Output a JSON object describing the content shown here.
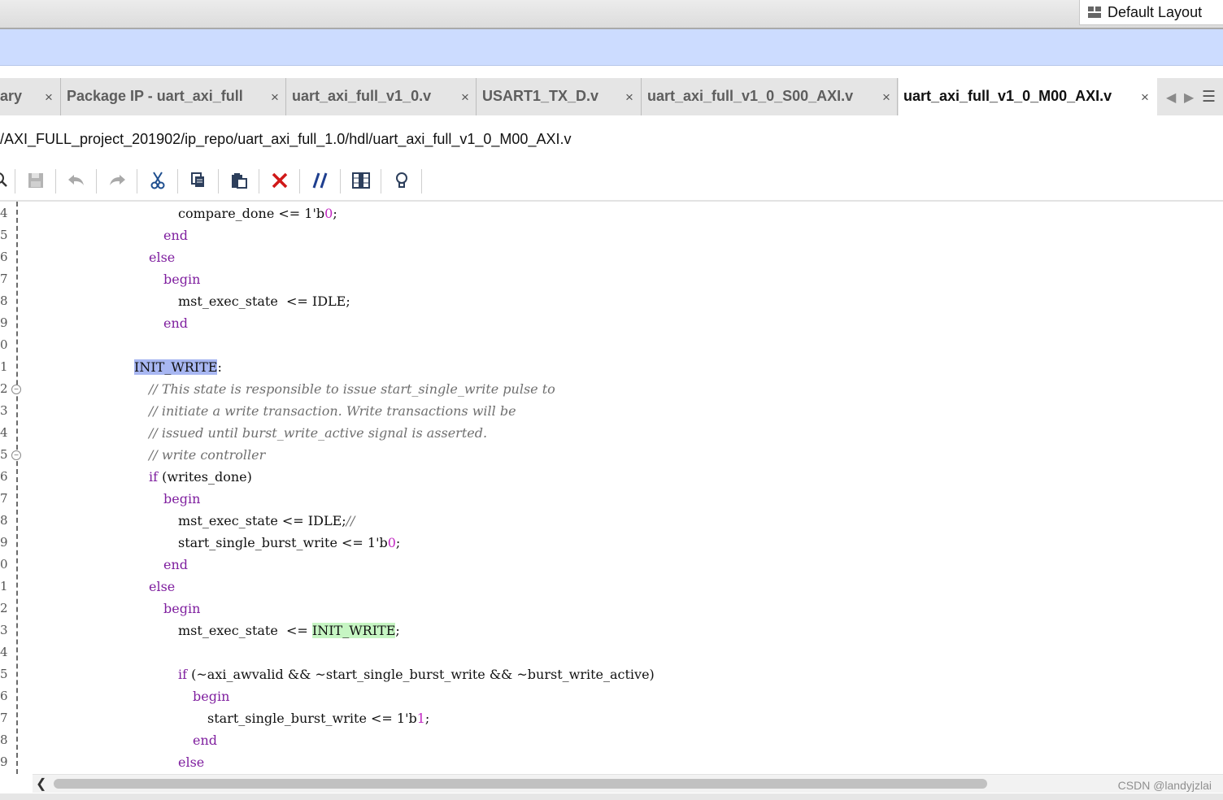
{
  "top_bar": {
    "layout_label": "Default Layout"
  },
  "tabs": [
    {
      "label": "ary",
      "active": false
    },
    {
      "label": "Package IP - uart_axi_full",
      "active": false
    },
    {
      "label": "uart_axi_full_v1_0.v",
      "active": false
    },
    {
      "label": "USART1_TX_D.v",
      "active": false
    },
    {
      "label": "uart_axi_full_v1_0_S00_AXI.v",
      "active": false
    },
    {
      "label": "uart_axi_full_v1_0_M00_AXI.v",
      "active": true
    }
  ],
  "close_glyph": "×",
  "file_path": "/AXI_FULL_project_201902/ip_repo/uart_axi_full_1.0/hdl/uart_axi_full_v1_0_M00_AXI.v",
  "toolbar_icons": [
    "search-icon",
    "save-icon",
    "undo-icon",
    "redo-icon",
    "cut-icon",
    "copy-icon",
    "paste-icon",
    "delete-icon",
    "comment-icon",
    "column-select-icon",
    "quick-help-icon"
  ],
  "line_numbers": [
    "4",
    "5",
    "6",
    "7",
    "8",
    "9",
    "0",
    "1",
    "2",
    "3",
    "4",
    "5",
    "6",
    "7",
    "8",
    "9",
    "0",
    "1",
    "2",
    "3",
    "4",
    "5",
    "6",
    "7",
    "8",
    "9"
  ],
  "code_lines": [
    {
      "indent": 0,
      "tokens": [
        {
          "t": "compare_done <= 1'b"
        },
        {
          "t": "0",
          "c": "num"
        },
        {
          "t": ";"
        }
      ]
    },
    {
      "indent": 1,
      "tokens": [
        {
          "t": "end",
          "c": "kw"
        }
      ]
    },
    {
      "indent": 2,
      "tokens": [
        {
          "t": "else",
          "c": "kw"
        }
      ]
    },
    {
      "indent": 3,
      "tokens": [
        {
          "t": "begin",
          "c": "kw"
        }
      ]
    },
    {
      "indent": 0,
      "tokens": [
        {
          "t": "mst_exec_state  <= IDLE;"
        }
      ]
    },
    {
      "indent": 1,
      "tokens": [
        {
          "t": "end",
          "c": "kw"
        }
      ]
    },
    {
      "indent": 4,
      "tokens": []
    },
    {
      "indent": 5,
      "tokens": [
        {
          "t": "INIT_WRITE",
          "c": "sel"
        },
        {
          "t": ":"
        }
      ]
    },
    {
      "indent": 2,
      "tokens": [
        {
          "t": "// This state is responsible to issue start_single_write pulse to",
          "c": "cmt"
        }
      ]
    },
    {
      "indent": 2,
      "tokens": [
        {
          "t": "// initiate a write transaction. Write transactions will be",
          "c": "cmt"
        }
      ]
    },
    {
      "indent": 2,
      "tokens": [
        {
          "t": "// issued until burst_write_active signal is asserted.",
          "c": "cmt"
        }
      ]
    },
    {
      "indent": 2,
      "tokens": [
        {
          "t": "// write controller",
          "c": "cmt"
        }
      ]
    },
    {
      "indent": 2,
      "tokens": [
        {
          "t": "if",
          "c": "kw"
        },
        {
          "t": " (writes_done)"
        }
      ]
    },
    {
      "indent": 3,
      "tokens": [
        {
          "t": "begin",
          "c": "kw"
        }
      ]
    },
    {
      "indent": 0,
      "tokens": [
        {
          "t": "mst_exec_state <= IDLE;"
        },
        {
          "t": "//",
          "c": "cmt"
        }
      ]
    },
    {
      "indent": 0,
      "tokens": [
        {
          "t": "start_single_burst_write <= 1'b"
        },
        {
          "t": "0",
          "c": "num"
        },
        {
          "t": ";"
        }
      ]
    },
    {
      "indent": 1,
      "tokens": [
        {
          "t": "end",
          "c": "kw"
        }
      ]
    },
    {
      "indent": 2,
      "tokens": [
        {
          "t": "else",
          "c": "kw"
        }
      ]
    },
    {
      "indent": 3,
      "tokens": [
        {
          "t": "begin",
          "c": "kw"
        }
      ]
    },
    {
      "indent": 0,
      "tokens": [
        {
          "t": "mst_exec_state  <= "
        },
        {
          "t": "INIT_WRITE",
          "c": "match"
        },
        {
          "t": ";"
        }
      ]
    },
    {
      "indent": 4,
      "tokens": []
    },
    {
      "indent": 0,
      "tokens": [
        {
          "t": "if",
          "c": "kw"
        },
        {
          "t": " (~axi_awvalid && ~start_single_burst_write && ~burst_write_active)"
        }
      ]
    },
    {
      "indent": 6,
      "tokens": [
        {
          "t": "begin",
          "c": "kw"
        }
      ]
    },
    {
      "indent": 7,
      "tokens": [
        {
          "t": "start_single_burst_write <= 1'b"
        },
        {
          "t": "1",
          "c": "num"
        },
        {
          "t": ";"
        }
      ]
    },
    {
      "indent": 6,
      "tokens": [
        {
          "t": "end",
          "c": "kw"
        }
      ]
    },
    {
      "indent": 0,
      "tokens": [
        {
          "t": "else",
          "c": "kw"
        }
      ]
    }
  ],
  "watermark": "CSDN @landyjzlai"
}
